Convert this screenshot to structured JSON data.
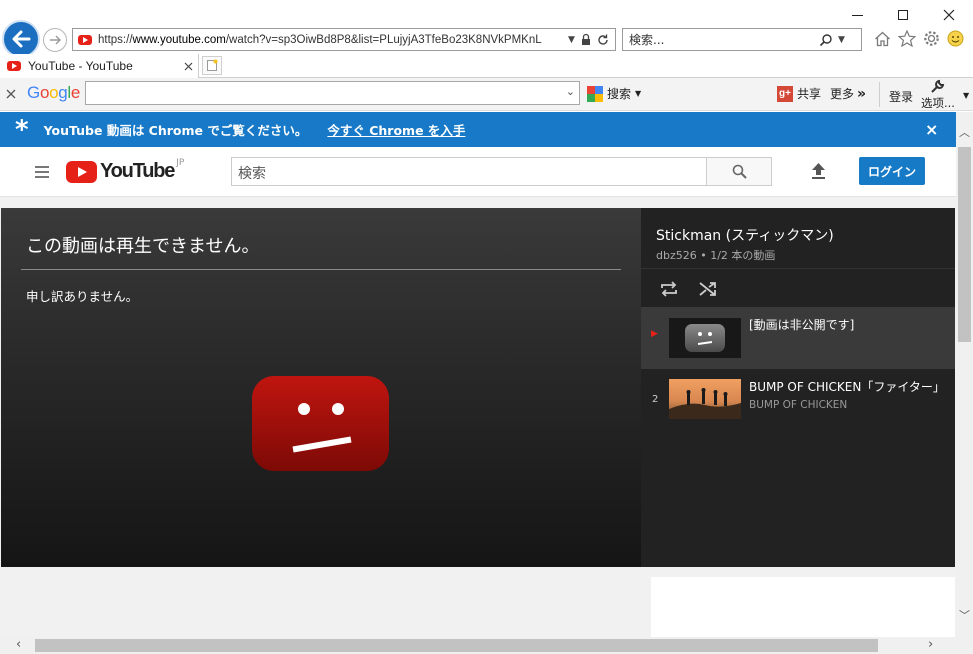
{
  "window": {
    "minimize_glyph": "—",
    "maximize_glyph": "☐",
    "close_glyph": "✕"
  },
  "nav": {
    "url": "https://www.youtube.com/watch?v=sp3OiwBd8P8&list=PLujyjA3TfeBo23K8NVkPMKnL",
    "url_host": "www.youtube.com",
    "search_placeholder": "検索...",
    "search_glyph": "⌕"
  },
  "tabs": [
    {
      "label": "YouTube - YouTube",
      "active": true
    }
  ],
  "google_toolbar": {
    "logo": "Google",
    "search_button": "搜索",
    "share_label": "共享",
    "more_label": "更多",
    "more_chevrons": "»",
    "signin_label": "登录",
    "options_label": "选项..."
  },
  "promo": {
    "star": "*",
    "message": "YouTube 動画は Chrome でご覧ください。",
    "link": "今すぐ Chrome を入手",
    "close": "×"
  },
  "youtube": {
    "logo_text": "YouTube",
    "region": "JP",
    "search_placeholder": "検索",
    "login_button": "ログイン",
    "accent_color": "#e62117",
    "login_color": "#167ac6"
  },
  "player": {
    "error_title": "この動画は再生できません。",
    "error_sub": "申し訳ありません。"
  },
  "playlist": {
    "title": "Stickman (スティックマン)",
    "meta": "dbz526 • 1/2 本の動画",
    "items": [
      {
        "index": "▶",
        "title": "[動画は非公開です]",
        "channel": "",
        "active": true
      },
      {
        "index": "2",
        "title": "BUMP OF CHICKEN「ファイター」",
        "channel": "BUMP OF CHICKEN",
        "active": false
      }
    ]
  }
}
